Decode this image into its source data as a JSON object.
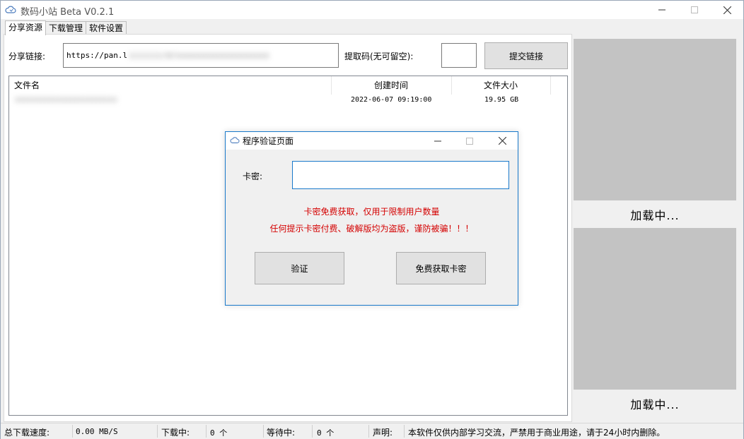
{
  "window": {
    "title": "数码小站 Beta V0.2.1"
  },
  "tabs": [
    {
      "label": "分享资源",
      "active": true
    },
    {
      "label": "下载管理",
      "active": false
    },
    {
      "label": "软件设置",
      "active": false
    }
  ],
  "share": {
    "link_label": "分享链接:",
    "link_value_visible": "https://pan.l",
    "link_value_obscured": "iiiiiii/d/xxxxxxxxxxxxxxxxxxxx",
    "code_label": "提取码(无可留空):",
    "code_value": "",
    "submit_label": "提交链接"
  },
  "file_list": {
    "columns": [
      "文件名",
      "创建时间",
      "文件大小"
    ],
    "rows": [
      {
        "name_obscured": "xxxxxxxxxxxxxxxxxxxxxxxx",
        "created": "2022-06-07 09:19:00",
        "size": "19.95 GB"
      }
    ]
  },
  "ads": [
    {
      "label": "加载中..."
    },
    {
      "label": "加载中..."
    }
  ],
  "status": {
    "total_speed_label": "总下载速度:",
    "total_speed_value": "0.00 MB/S",
    "downloading_label": "下载中:",
    "downloading_value": "0 个",
    "waiting_label": "等待中:",
    "waiting_value": "0 个",
    "notice_label": "声明:",
    "notice_text": "本软件仅供内部学习交流，严禁用于商业用途，请于24小时内删除。"
  },
  "dialog": {
    "title": "程序验证页面",
    "key_label": "卡密:",
    "key_value": "",
    "warning_line1": "卡密免费获取，仅用于限制用户数量",
    "warning_line2": "任何提示卡密付费、破解版均为盗版，谨防被骗！！！",
    "verify_label": "验证",
    "get_key_label": "免费获取卡密"
  },
  "colors": {
    "warning": "#d40000",
    "dialog_border": "#1979ca",
    "ad_placeholder": "#c3c3c3"
  }
}
